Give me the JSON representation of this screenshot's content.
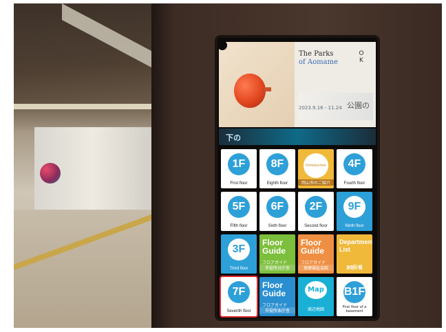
{
  "banner": {
    "title_line1": "The Parks",
    "title_line2": "of Aomame",
    "date": "2023.9.16 - 11.24",
    "jp_text": "公園の",
    "sub_text": "下の"
  },
  "tiles": [
    {
      "label": "First floor",
      "badge": "1F",
      "style": "white"
    },
    {
      "label": "Eighth floor",
      "badge": "8F",
      "style": "white"
    },
    {
      "label": "岡山市のご紹介",
      "badge": "Introduction",
      "style": "yellow"
    },
    {
      "label": "Fourth floor",
      "badge": "4F",
      "style": "white"
    },
    {
      "label": "Fifth floor",
      "badge": "5F",
      "style": "white"
    },
    {
      "label": "Sixth floor",
      "badge": "6F",
      "style": "white"
    },
    {
      "label": "Second floor",
      "badge": "2F",
      "style": "white"
    },
    {
      "label": "Ninth floor",
      "badge": "9F",
      "style": "blue"
    },
    {
      "label": "Third floor",
      "badge": "3F",
      "style": "blue"
    },
    {
      "label": "市役所分庁舎",
      "badge": "Floor Guide",
      "style": "green",
      "sub": "フロアガイド"
    },
    {
      "label": "保健福祉会館",
      "badge": "Floor Guide",
      "style": "orange",
      "sub": "フロアガイド"
    },
    {
      "label": "部署一覧",
      "badge": "Department List",
      "style": "yellow",
      "sub": "50音順"
    },
    {
      "label": "Seventh floor",
      "badge": "7F",
      "style": "white",
      "highlight": true
    },
    {
      "label": "市役所本庁舎",
      "badge": "Floor Guide",
      "style": "navy",
      "sub": "フロアガイド"
    },
    {
      "label": "周辺地図",
      "badge": "Map",
      "style": "cyan"
    },
    {
      "label": "First floor of a basement",
      "badge": "B1F",
      "style": "white"
    }
  ]
}
